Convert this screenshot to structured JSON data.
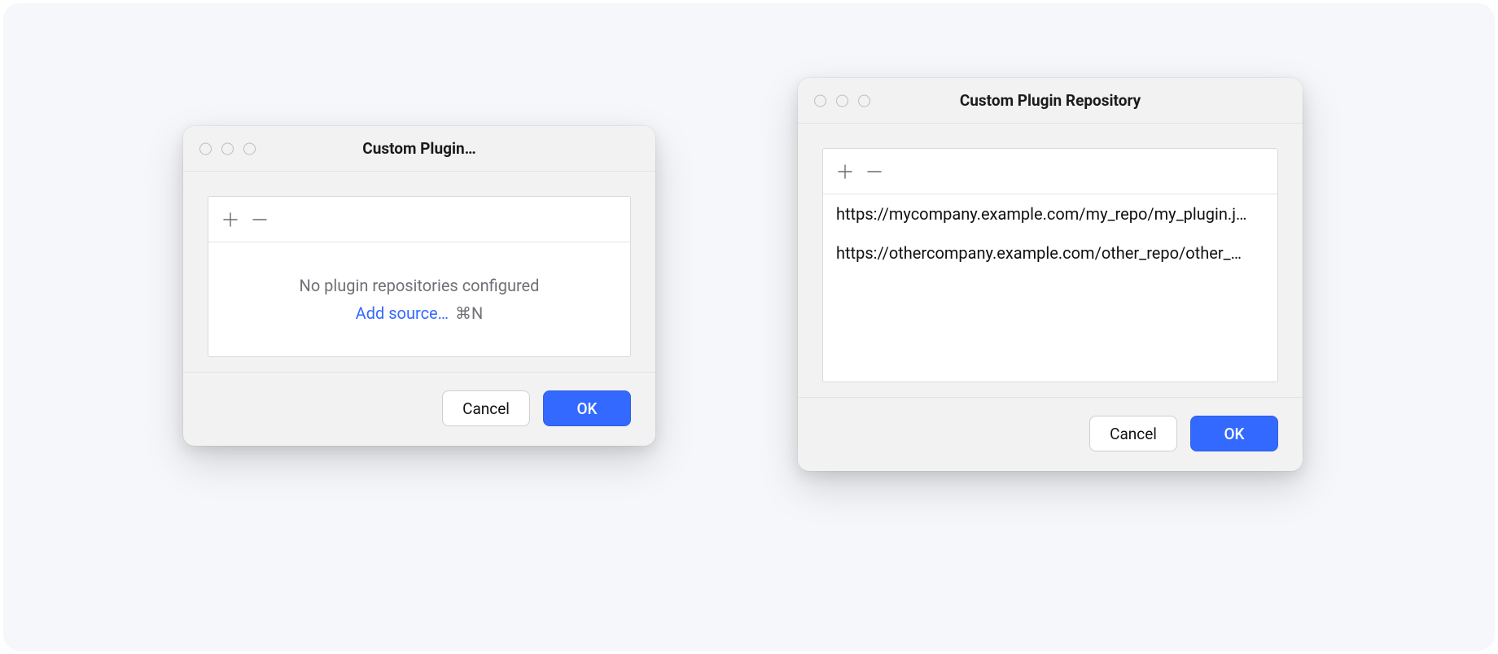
{
  "dialog1": {
    "title": "Custom Plugin…",
    "empty_label": "No plugin repositories configured",
    "add_link_label": "Add source…",
    "add_shortcut": "⌘N",
    "cancel_label": "Cancel",
    "ok_label": "OK"
  },
  "dialog2": {
    "title": "Custom Plugin Repository",
    "repos": [
      "https://mycompany.example.com/my_repo/my_plugin.j…",
      "https://othercompany.example.com/other_repo/other_…"
    ],
    "cancel_label": "Cancel",
    "ok_label": "OK"
  },
  "icons": {
    "plus": "plus-icon",
    "minus": "minus-icon"
  },
  "colors": {
    "accent": "#3369ff",
    "canvas": "#f5f7fa",
    "dialog_bg": "#f2f2f2"
  }
}
